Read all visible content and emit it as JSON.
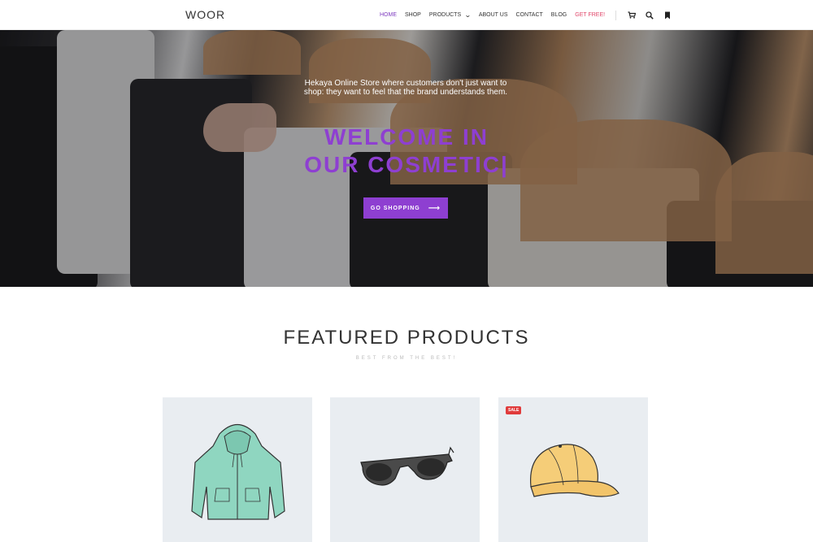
{
  "header": {
    "logo": "WOOR",
    "nav": [
      {
        "label": "HOME",
        "active": true
      },
      {
        "label": "SHOP"
      },
      {
        "label": "PRODUCTS",
        "dropdown": true
      },
      {
        "label": "ABOUT US"
      },
      {
        "label": "CONTACT"
      },
      {
        "label": "BLOG"
      },
      {
        "label": "GET FREE!",
        "highlight": true
      }
    ],
    "icons": [
      "cart-icon",
      "search-icon",
      "bookmark-icon"
    ]
  },
  "hero": {
    "tagline": "Hekaya Online Store where customers don't just want to shop: they want to feel that the brand understands them.",
    "title_line1": "WELCOME IN",
    "title_line2": "OUR COSMETIC|",
    "button_label": "GO SHOPPING",
    "accent_color": "#8e3fd1"
  },
  "featured": {
    "title": "FEATURED PRODUCTS",
    "subtitle": "BEST FROM THE BEST!",
    "products": [
      {
        "name": "hoodie",
        "badge": ""
      },
      {
        "name": "sunglasses",
        "badge": ""
      },
      {
        "name": "cap",
        "badge": "SALE"
      }
    ]
  }
}
